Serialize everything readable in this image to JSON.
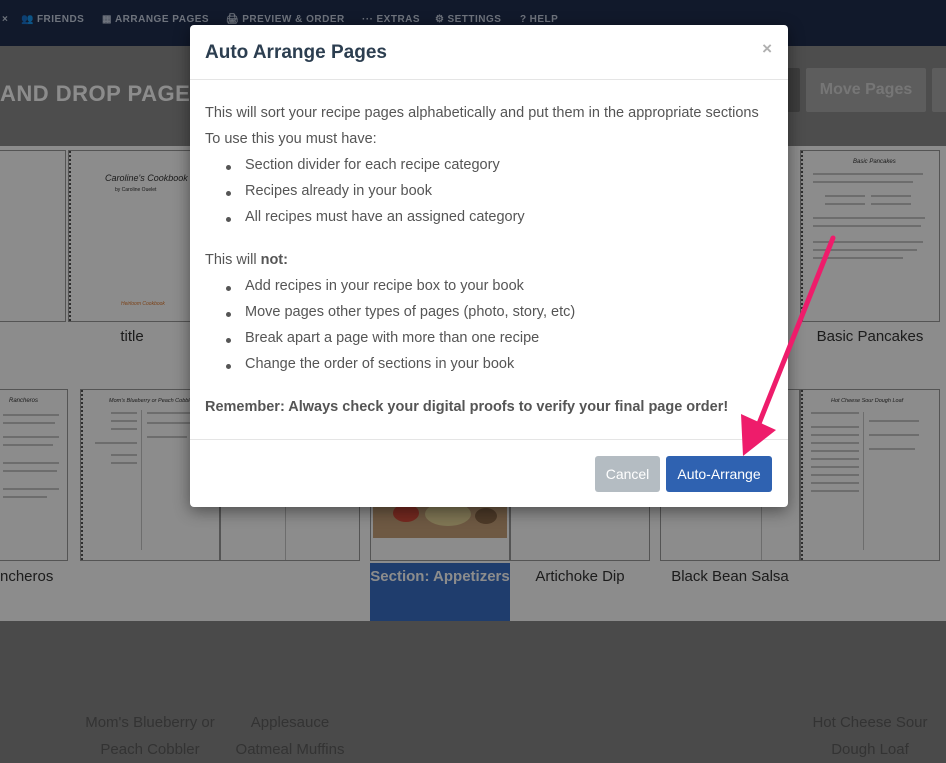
{
  "nav": {
    "items": [
      {
        "icon": "users-icon",
        "glyph": "👥",
        "label": "FRIENDS"
      },
      {
        "icon": "grid-icon",
        "glyph": "▦",
        "label": "ARRANGE PAGES"
      },
      {
        "icon": "print-icon",
        "glyph": "🖨",
        "label": "PREVIEW & ORDER"
      },
      {
        "icon": "dots-icon",
        "glyph": "···",
        "label": "EXTRAS"
      },
      {
        "icon": "gear-icon",
        "glyph": "⚙",
        "label": "SETTINGS"
      },
      {
        "icon": "question-icon",
        "glyph": "?",
        "label": "HELP"
      }
    ]
  },
  "header": {
    "title": "AND DROP PAGES",
    "move_pages_label": "Move Pages"
  },
  "pages": {
    "row1": {
      "title_label": "title",
      "pancakes_label": "Basic Pancakes",
      "cookbook_title": "Caroline's Cookbook",
      "cookbook_sub": "by Caroline Ouelet",
      "cookbook_logo": "Heirloom Cookbook",
      "pancakes_heading": "Basic Pancakes"
    },
    "row2": {
      "rancheros_label": "ncheros",
      "cobbler_label_1": "Mom's Blueberry or",
      "cobbler_label_2": "Peach Cobbler",
      "applesauce_label_1": "Applesauce",
      "applesauce_label_2": "Oatmeal Muffins",
      "appetizers_label": "Section: Appetizers",
      "artichoke_label": "Artichoke Dip",
      "salsa_label": "Black Bean Salsa",
      "hotcheese_label_1": "Hot Cheese Sour",
      "hotcheese_label_2": "Dough Loaf",
      "cobbler_heading": "Mom's Blueberry or Peach Cobbler",
      "hotcheese_heading": "Hot Cheese Sour Dough Loaf",
      "rancheros_heading": "Rancheros"
    }
  },
  "modal": {
    "title": "Auto Arrange Pages",
    "close": "×",
    "intro": "This will sort your recipe pages alphabetically and put them in the appropriate sections",
    "must_have": "To use this you must have:",
    "requirements": [
      "Section divider for each recipe category",
      "Recipes already in your book",
      "All recipes must have an assigned category"
    ],
    "will_not_prefix": "This will ",
    "will_not_bold": "not:",
    "limitations": [
      "Add recipes in your recipe box to your book",
      "Move pages other types of pages (photo, story, etc)",
      "Break apart a page with more than one recipe",
      "Change the order of sections in your book"
    ],
    "remember": "Remember: Always check your digital proofs to verify your final page order!",
    "cancel_label": "Cancel",
    "confirm_label": "Auto-Arrange"
  },
  "colors": {
    "nav_bg": "#1f2f4f",
    "primary_button": "#2f62b1",
    "cancel_button": "#b4bcc2",
    "selected_label": "#3a70c6",
    "annotation_arrow": "#ee1c6b"
  }
}
